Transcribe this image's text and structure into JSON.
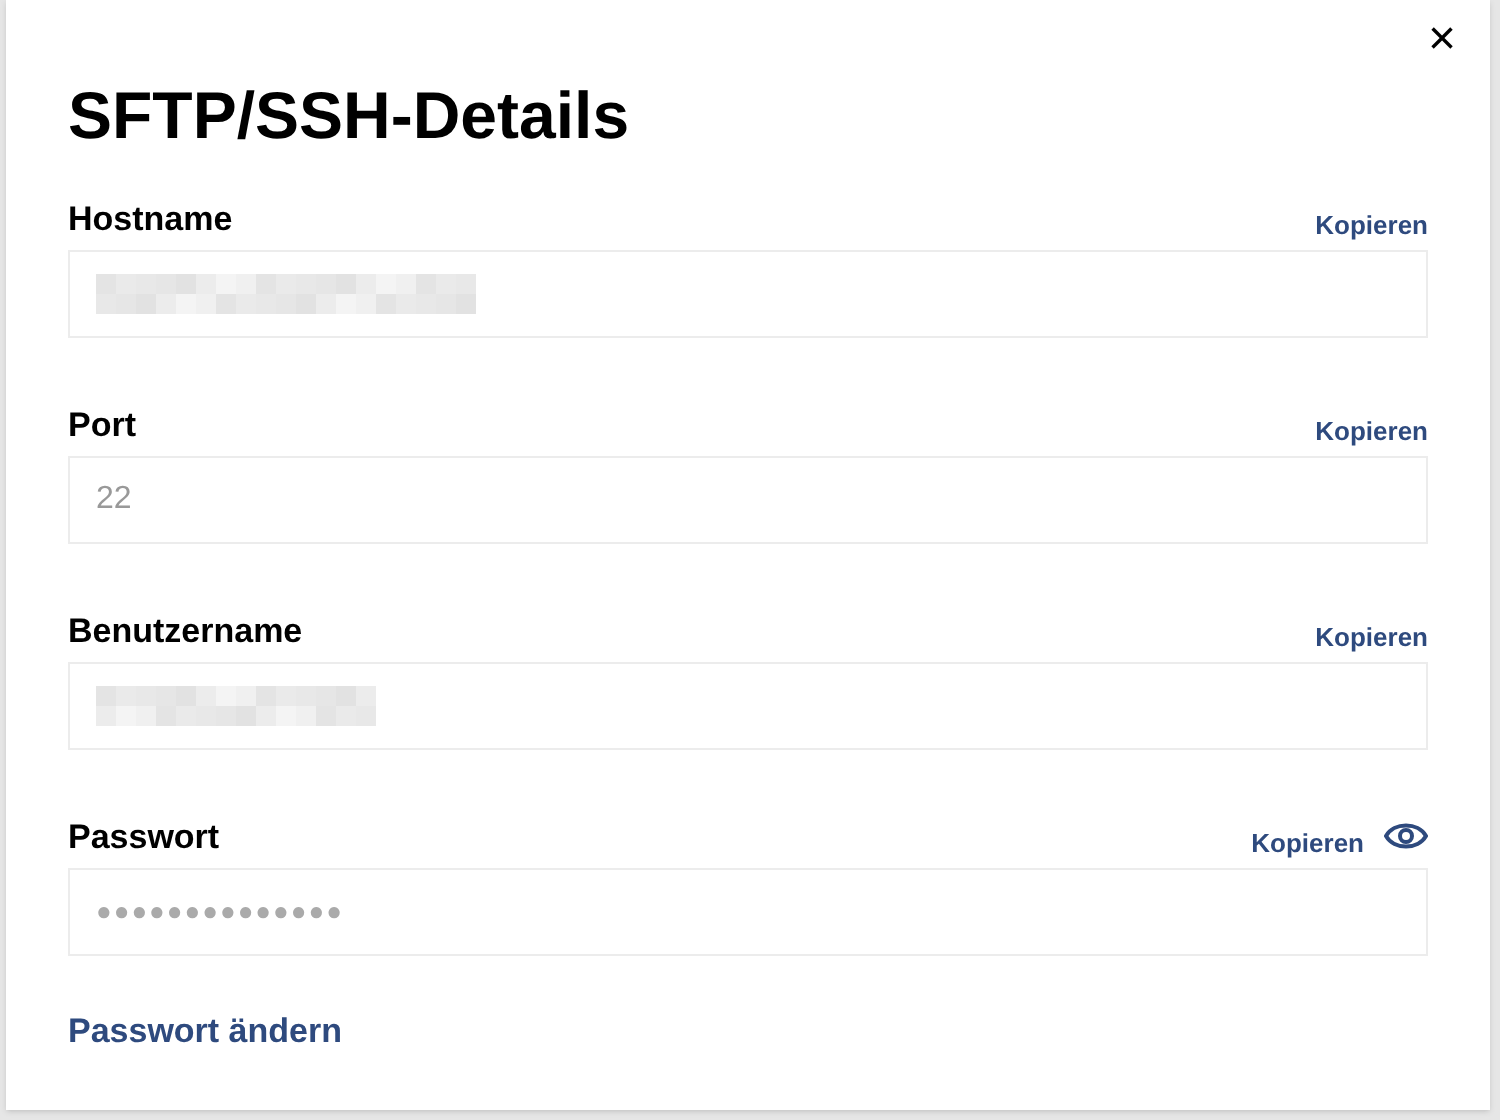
{
  "dialog": {
    "title": "SFTP/SSH-Details",
    "close": "×"
  },
  "fields": [
    {
      "label": "Hostname",
      "kind": "text",
      "copy": "Kopieren",
      "redacted": true
    },
    {
      "label": "Port",
      "kind": "text",
      "copy": "Kopieren",
      "value": "22",
      "redacted": false
    },
    {
      "label": "Benutzername",
      "kind": "text",
      "copy": "Kopieren",
      "redacted": true
    },
    {
      "label": "Passwort",
      "kind": "password",
      "copy": "Kopieren",
      "value": "●●●●●●●●●●●●●●",
      "redacted": false
    }
  ],
  "link": "Passwort ändern"
}
